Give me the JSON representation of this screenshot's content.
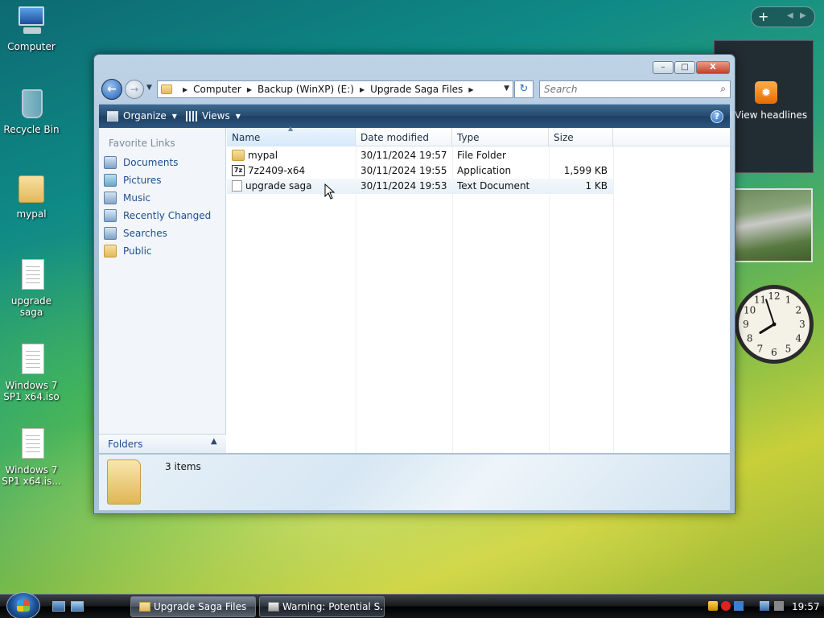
{
  "desktop": {
    "icons": [
      {
        "label": "Computer"
      },
      {
        "label": "Recycle Bin"
      },
      {
        "label": "mypal"
      },
      {
        "label": "upgrade saga"
      },
      {
        "label": "Windows 7 SP1 x64.iso"
      },
      {
        "label": "Windows 7 SP1 x64.is..."
      }
    ]
  },
  "sidebar": {
    "add_label": "+",
    "feed_label": "View headlines",
    "clock_numbers": [
      "12",
      "1",
      "2",
      "3",
      "4",
      "5",
      "6",
      "7",
      "8",
      "9",
      "10",
      "11"
    ],
    "clock_time": {
      "hour": 7,
      "minute": 57
    }
  },
  "window": {
    "title": "",
    "controls": {
      "minimize": "–",
      "maximize": "□",
      "close": "X"
    },
    "breadcrumb": [
      "Computer",
      "Backup (WinXP) (E:)",
      "Upgrade Saga Files"
    ],
    "search_placeholder": "Search",
    "toolbar": {
      "organize": "Organize",
      "views": "Views",
      "help": "?"
    },
    "nav": {
      "heading": "Favorite Links",
      "items": [
        {
          "label": "Documents",
          "icon": "documents-icon"
        },
        {
          "label": "Pictures",
          "icon": "pictures-icon"
        },
        {
          "label": "Music",
          "icon": "music-icon"
        },
        {
          "label": "Recently Changed",
          "icon": "recently-changed-icon"
        },
        {
          "label": "Searches",
          "icon": "searches-icon"
        },
        {
          "label": "Public",
          "icon": "public-folder-icon"
        }
      ],
      "folders_label": "Folders"
    },
    "columns": [
      "Name",
      "Date modified",
      "Type",
      "Size"
    ],
    "files": [
      {
        "name": "mypal",
        "date": "30/11/2024 19:57",
        "type": "File Folder",
        "size": "",
        "icon": "folder-icon"
      },
      {
        "name": "7z2409-x64",
        "date": "30/11/2024 19:55",
        "type": "Application",
        "size": "1,599 KB",
        "icon": "7zip-app-icon"
      },
      {
        "name": "upgrade saga",
        "date": "30/11/2024 19:53",
        "type": "Text Document",
        "size": "1 KB",
        "icon": "text-document-icon"
      }
    ],
    "details": {
      "count": "3 items"
    }
  },
  "taskbar": {
    "tasks": [
      {
        "label": "Upgrade Saga Files",
        "active": true
      },
      {
        "label": "Warning: Potential S...",
        "active": false
      }
    ],
    "time": "19:57"
  }
}
